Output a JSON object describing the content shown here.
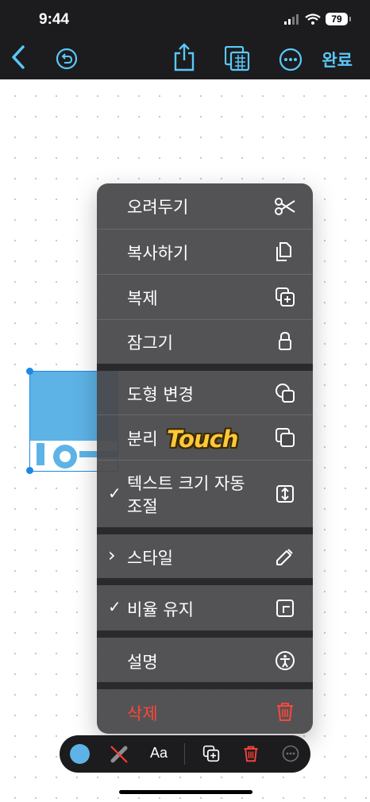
{
  "status": {
    "time": "9:44",
    "battery": "79"
  },
  "toolbar_top": {
    "done_label": "완료"
  },
  "menu": {
    "cut": "오려두기",
    "copy": "복사하기",
    "duplicate": "복제",
    "lock": "잠그기",
    "change_shape": "도형 변경",
    "detach": "분리",
    "autosize_text": "텍스트 크기 자동 조절",
    "autosize_checked": "✓",
    "style": "스타일",
    "style_chevron": "›",
    "constrain": "비율 유지",
    "constrain_checked": "✓",
    "description": "설명",
    "delete": "삭제"
  },
  "overlay": {
    "touch": "Touch"
  },
  "bottom_toolbar": {
    "text_style": "Aa"
  },
  "colors": {
    "accent": "#5ac8fa",
    "shape_fill": "#5db3e6",
    "delete": "#ff453a",
    "menu_bg": "#48484a"
  }
}
